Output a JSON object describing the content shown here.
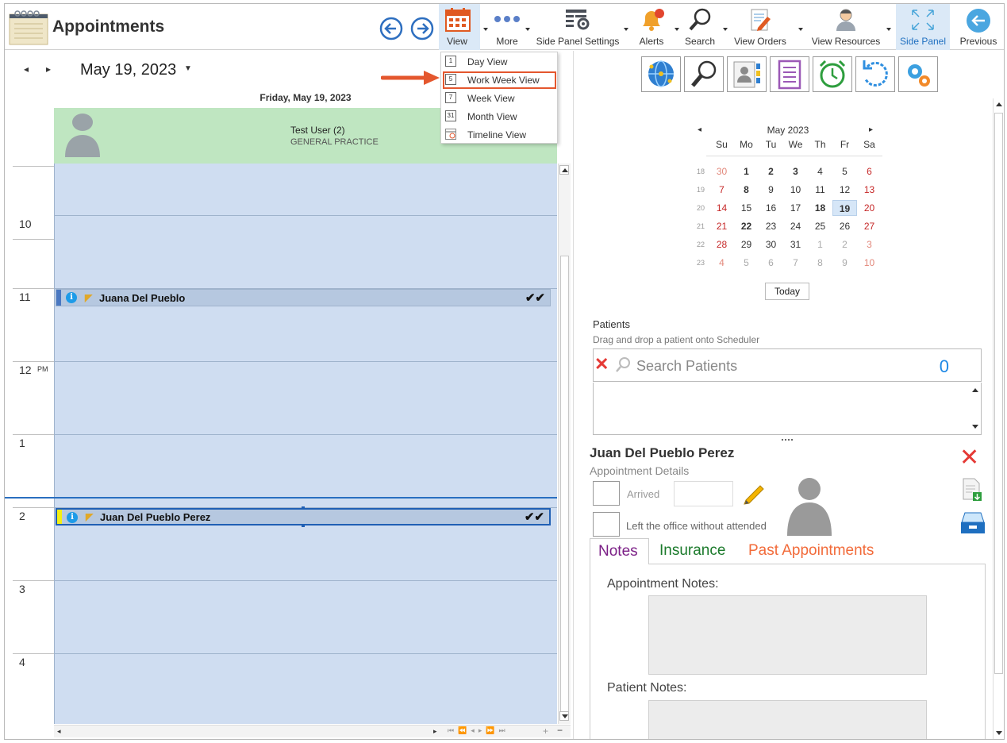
{
  "app": {
    "title": "Appointments"
  },
  "toolbar": {
    "view": "View",
    "more": "More",
    "side_panel_settings": "Side Panel Settings",
    "alerts": "Alerts",
    "search": "Search",
    "view_orders": "View Orders",
    "view_resources": "View Resources",
    "side_panel": "Side Panel",
    "previous": "Previous"
  },
  "view_menu": {
    "items": [
      {
        "label": "Day View",
        "icon_text": "1"
      },
      {
        "label": "Work Week View",
        "icon_text": "5"
      },
      {
        "label": "Week View",
        "icon_text": "7"
      },
      {
        "label": "Month View",
        "icon_text": "31"
      },
      {
        "label": "Timeline View",
        "icon_text": ""
      }
    ],
    "highlighted": "Work Week View"
  },
  "scheduler": {
    "date_label": "May 19, 2023",
    "day_header": "Friday, May 19, 2023",
    "resource_name": "Test User (2)",
    "resource_dept": "GENERAL PRACTICE",
    "hours": [
      {
        "label": "10",
        "suffix": ""
      },
      {
        "label": "11",
        "suffix": ""
      },
      {
        "label": "12",
        "suffix": "PM"
      },
      {
        "label": "1",
        "suffix": ""
      },
      {
        "label": "2",
        "suffix": ""
      },
      {
        "label": "3",
        "suffix": ""
      },
      {
        "label": "4",
        "suffix": ""
      }
    ],
    "appointments": [
      {
        "name": "Juana Del Pueblo",
        "status": "✔✔",
        "color": "#4a78c2"
      },
      {
        "name": "Juan Del Pueblo Perez",
        "status": "✔✔",
        "color": "#f3ef14"
      }
    ]
  },
  "calendar": {
    "month_label": "May 2023",
    "day_headers": [
      "Su",
      "Mo",
      "Tu",
      "We",
      "Th",
      "Fr",
      "Sa"
    ],
    "week_numbers": [
      "18",
      "19",
      "20",
      "21",
      "22",
      "23"
    ],
    "days": [
      [
        "30",
        "1",
        "2",
        "3",
        "4",
        "5",
        "6"
      ],
      [
        "7",
        "8",
        "9",
        "10",
        "11",
        "12",
        "13"
      ],
      [
        "14",
        "15",
        "16",
        "17",
        "18",
        "19",
        "20"
      ],
      [
        "21",
        "22",
        "23",
        "24",
        "25",
        "26",
        "27"
      ],
      [
        "28",
        "29",
        "30",
        "31",
        "1",
        "2",
        "3"
      ],
      [
        "4",
        "5",
        "6",
        "7",
        "8",
        "9",
        "10"
      ]
    ],
    "selected_day": "19",
    "today_button": "Today"
  },
  "patients": {
    "title": "Patients",
    "hint": "Drag and drop a patient onto Scheduler",
    "search_placeholder": "Search Patients",
    "count": "0"
  },
  "details": {
    "patient_name": "Juan Del Pueblo Perez",
    "subtitle": "Appointment Details",
    "arrived_label": "Arrived",
    "left_label": "Left the office without attended",
    "tabs": [
      "Notes",
      "Insurance",
      "Past Appointments"
    ],
    "appointment_notes_label": "Appointment Notes:",
    "patient_notes_label": "Patient Notes:"
  },
  "colors": {
    "accent": "#1e88e5",
    "calendar_red": "#c62828",
    "resource_header": "#bfe6c1",
    "schedule_bg": "#cfddf1",
    "tab_notes": "#7b1f86",
    "tab_insurance": "#1b7a2b",
    "tab_past": "#f26b3a"
  }
}
